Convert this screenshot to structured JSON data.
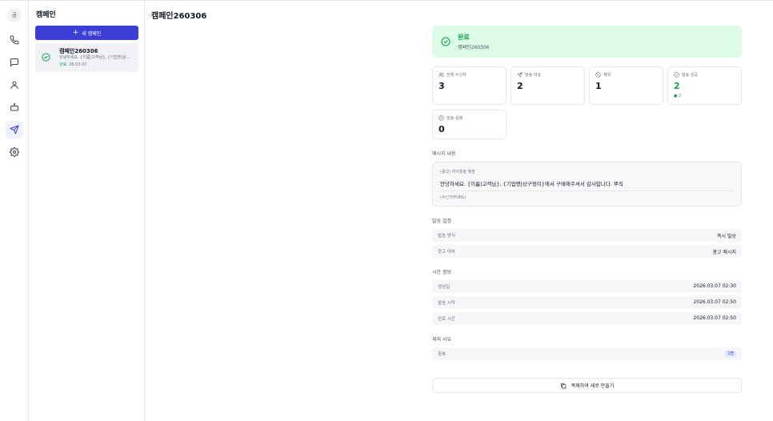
{
  "rail": {
    "logo": "공",
    "items": [
      {
        "icon": "phone-icon"
      },
      {
        "icon": "chat-icon"
      },
      {
        "icon": "user-icon"
      },
      {
        "icon": "robot-icon"
      },
      {
        "icon": "send-icon",
        "active": true
      },
      {
        "icon": "gear-icon"
      }
    ]
  },
  "list": {
    "title": "캠페인",
    "new_button": "새 캠페인",
    "items": [
      {
        "name": "캠페인260306",
        "preview": "안녕하세요. {이름|고객님}, {기업명|상...",
        "status": "완료",
        "date": "26.03.07"
      }
    ]
  },
  "main": {
    "title": "캠페인260306",
    "status": {
      "label": "완료",
      "sub": "캠페인260306"
    },
    "stats": [
      {
        "label": "전체 수신자",
        "value": "3",
        "icon": "users-icon"
      },
      {
        "label": "발송 대상",
        "value": "2",
        "icon": "send-icon"
      },
      {
        "label": "제외",
        "value": "1",
        "icon": "ban-icon"
      },
      {
        "label": "발송 성공",
        "value": "2",
        "icon": "check-circle-icon",
        "sub": "● 2",
        "color": "#16a34a"
      },
      {
        "label": "발송 실패",
        "value": "0",
        "icon": "x-circle-icon"
      }
    ],
    "message": {
      "section": "메시지 내용",
      "top": "(광고) 마크툴을 행판",
      "body": "안녕하세요. {이름|고객님}, {기업명|상구정이}에서 구매해주셔서 감사합니다. 뿌직",
      "foot": "(수신거부URL)"
    },
    "send_settings": {
      "section": "발송 설정",
      "rows": [
        {
          "key": "발송 방식",
          "value": "즉시 발송"
        },
        {
          "key": "광고 여부",
          "value": "광고 메시지"
        }
      ]
    },
    "time_info": {
      "section": "시간 정보",
      "rows": [
        {
          "key": "생성일",
          "value": "2026.03.07 02:30"
        },
        {
          "key": "발송 시작",
          "value": "2026.03.07 02:50"
        },
        {
          "key": "완료 시간",
          "value": "2026.03.07 02:50"
        }
      ]
    },
    "exclusion": {
      "section": "제외 사유",
      "rows": [
        {
          "key": "중복",
          "value": "1명"
        }
      ]
    },
    "copy_button": "복제하여 새로 만들기"
  },
  "colors": {
    "accent": "#3b3fd6",
    "success": "#16a34a",
    "success_bg": "#dcfce7"
  }
}
